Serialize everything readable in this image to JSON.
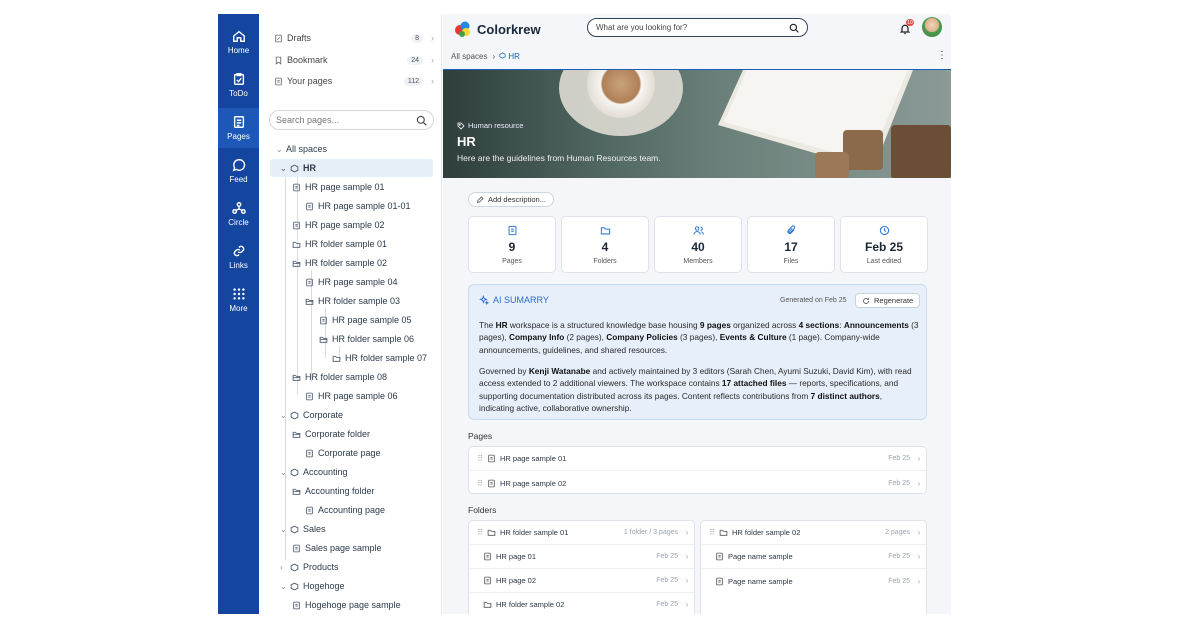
{
  "rail": [
    {
      "label": "Home",
      "icon": "home-icon"
    },
    {
      "label": "ToDo",
      "icon": "clipboard-icon"
    },
    {
      "label": "Pages",
      "icon": "pages-icon"
    },
    {
      "label": "Feed",
      "icon": "chat-icon"
    },
    {
      "label": "Circle",
      "icon": "circle-network-icon"
    },
    {
      "label": "Links",
      "icon": "link-icon"
    },
    {
      "label": "More",
      "icon": "grid-icon"
    }
  ],
  "sidebar": {
    "quick": [
      {
        "label": "Drafts",
        "count": "8"
      },
      {
        "label": "Bookmark",
        "count": "24"
      },
      {
        "label": "Your pages",
        "count": "112"
      }
    ],
    "search_placeholder": "Search pages...",
    "root": "All spaces",
    "tree": [
      "HR",
      "HR page sample 01",
      "HR page sample 01-01",
      "HR page sample 02",
      "HR folder sample 01",
      "HR folder sample 02",
      "HR page sample 04",
      "HR folder sample 03",
      "HR page sample 05",
      "HR folder sample 06",
      "HR folder sample 07",
      "HR folder sample 08",
      "HR page sample 06",
      "Corporate",
      "Corporate folder",
      "Corporate page",
      "Accounting",
      "Accounting folder",
      "Accounting page",
      "Sales",
      "Sales page sample",
      "Products",
      "Hogehoge",
      "Hogehoge page sample"
    ]
  },
  "header": {
    "brand": "Colorkrew",
    "search_placeholder": "What are you looking for?",
    "notif_count": "10"
  },
  "breadcrumb": {
    "root": "All spaces",
    "current": "HR"
  },
  "hero": {
    "tag": "Human resource",
    "title": "HR",
    "desc": "Here are the guidelines from Human Resources team."
  },
  "add_description": "Add description...",
  "stats": [
    {
      "value": "9",
      "label": "Pages"
    },
    {
      "value": "4",
      "label": "Folders"
    },
    {
      "value": "40",
      "label": "Members"
    },
    {
      "value": "17",
      "label": "Files"
    },
    {
      "value": "Feb 25",
      "label": "Last edited"
    }
  ],
  "ai": {
    "title": "AI SUMARRY",
    "generated": "Generated on Feb 25",
    "regenerate": "Regenerate",
    "p1": {
      "t1": "The ",
      "b1": "HR",
      "t2": " workspace is a structured knowledge base housing ",
      "b2": "9 pages",
      "t3": " organized across ",
      "b3": "4 sections",
      "t4": ": ",
      "b4": "Announcements",
      "t5": " (3 pages), ",
      "b5": "Company Info",
      "t6": " (2 pages), ",
      "b6": "Company Policies",
      "t7": " (3 pages), ",
      "b7": "Events & Culture",
      "t8": " (1 page). Company-wide announcements, guidelines, and shared resources."
    },
    "p2": {
      "t1": "Governed by ",
      "b1": "Kenji Watanabe",
      "t2": " and actively maintained by 3 editors (Sarah Chen, Ayumi Suzuki, David Kim), with read access extended to 2 additional viewers. The workspace contains ",
      "b2": "17 attached files",
      "t3": " — reports, specifications, and supporting documentation distributed across its pages. Content reflects contributions from ",
      "b3": "7 distinct authors",
      "t4": ", indicating active, collaborative ownership."
    }
  },
  "pages_title": "Pages",
  "pages": [
    {
      "name": "HR page sample 01",
      "date": "Feb 25"
    },
    {
      "name": "HR page sample 02",
      "date": "Feb 25"
    }
  ],
  "folders_title": "Folders",
  "folders": [
    {
      "name": "HR folder sample 01",
      "meta": "1 folder / 3 pages",
      "children": [
        {
          "name": "HR page 01",
          "date": "Feb 25"
        },
        {
          "name": "HR page 02",
          "date": "Feb 25"
        },
        {
          "name": "HR folder sample 02",
          "date": "Feb 25"
        }
      ]
    },
    {
      "name": "HR folder sample 02",
      "meta": "2 pages",
      "children": [
        {
          "name": "Page name sample",
          "date": "Feb 25"
        },
        {
          "name": "Page name sample",
          "date": "Feb 25"
        }
      ]
    }
  ]
}
